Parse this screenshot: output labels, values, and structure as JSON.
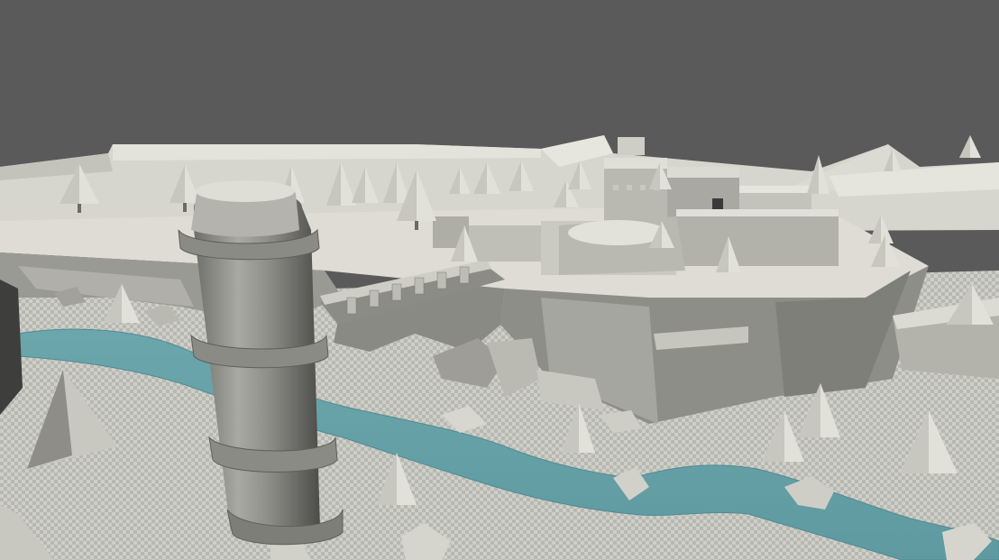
{
  "viewport": {
    "label": "",
    "render_style": "untextured grey-box 3D level",
    "sky_color": "#5a5a5a",
    "terrain_color": "#d6d5cc",
    "cliff_shadow_color": "#8c8c86",
    "water_color": "#6aa6ac",
    "ground_pattern": "checker"
  },
  "scene_objects": {
    "tower": "round-tower",
    "castle": "castle-keep",
    "bridge": "wooden-bridge",
    "river": "river",
    "trees": "pine-tree",
    "rocks": "boulder"
  }
}
